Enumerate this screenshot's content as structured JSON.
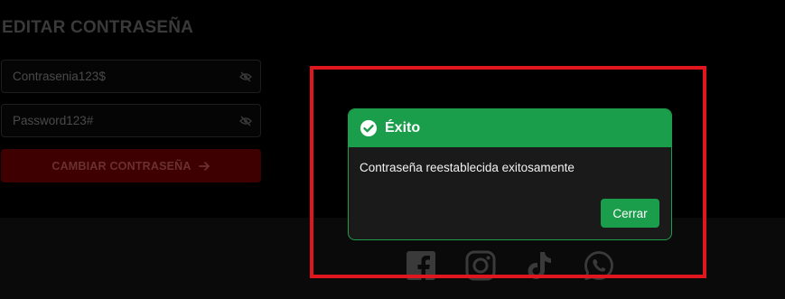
{
  "form": {
    "title": "EDITAR CONTRASEÑA",
    "new_password_value": "Contrasenia123$",
    "confirm_password_value": "Password123#",
    "submit_label": "CAMBIAR CONTRASEÑA",
    "submit_icon": "arrow-right-icon",
    "toggle_icon": "eye-slash-icon"
  },
  "footer": {
    "social": [
      {
        "icon": "facebook-icon"
      },
      {
        "icon": "instagram-icon"
      },
      {
        "icon": "tiktok-icon"
      },
      {
        "icon": "whatsapp-icon"
      }
    ]
  },
  "modal": {
    "title": "Éxito",
    "title_icon": "check-circle-icon",
    "message": "Contraseña reestablecida exitosamente",
    "close_label": "Cerrar"
  },
  "colors": {
    "success": "#1a9e4b",
    "highlight_frame": "#e0161e",
    "submit_button": "#3e0000"
  }
}
